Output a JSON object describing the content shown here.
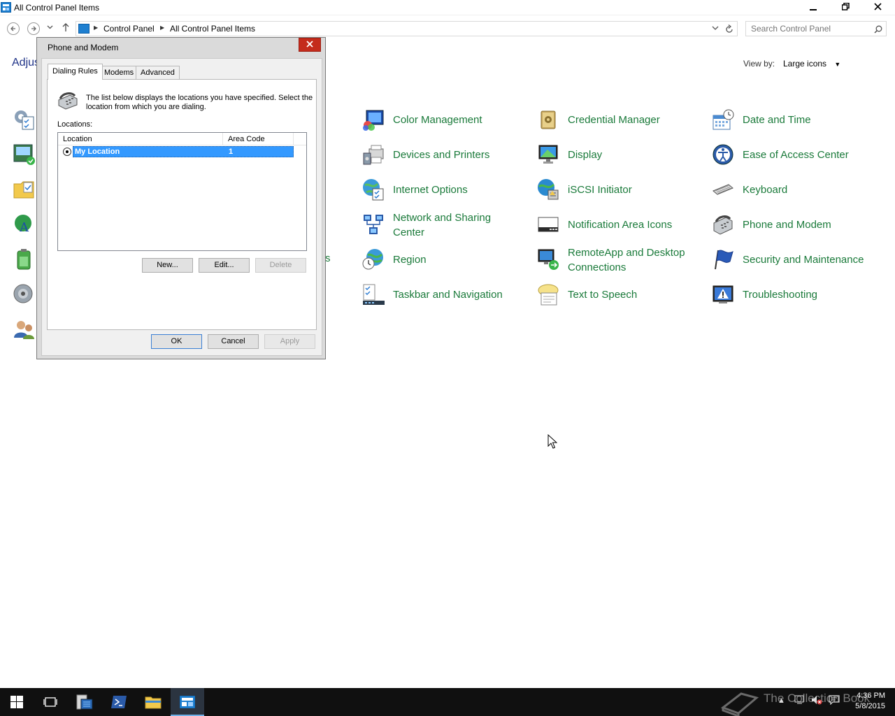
{
  "window": {
    "title": "All Control Panel Items",
    "minimize_glyph": "—",
    "maximize_glyph": "❐",
    "close_glyph": "✕"
  },
  "address": {
    "crumbs": [
      "Control Panel",
      "All Control Panel Items"
    ],
    "search_placeholder": "Search Control Panel"
  },
  "content": {
    "heading_partial": "Adjus",
    "view_by_label": "View by:",
    "view_by_value": "Large icons",
    "partial_item_suffix": "s"
  },
  "items": {
    "color_management": "Color Management",
    "credential_manager": "Credential Manager",
    "date_and_time": "Date and Time",
    "devices_and_printers": "Devices and Printers",
    "display": "Display",
    "ease_of_access": "Ease of Access Center",
    "internet_options": "Internet Options",
    "iscsi_initiator": "iSCSI Initiator",
    "keyboard": "Keyboard",
    "network_sharing_1": "Network and Sharing",
    "network_sharing_2": "Center",
    "notification_area": "Notification Area Icons",
    "phone_and_modem": "Phone and Modem",
    "region": "Region",
    "remoteapp_1": "RemoteApp and Desktop",
    "remoteapp_2": "Connections",
    "security_maintenance": "Security and Maintenance",
    "taskbar_navigation": "Taskbar and Navigation",
    "text_to_speech": "Text to Speech",
    "troubleshooting": "Troubleshooting"
  },
  "dialog": {
    "title": "Phone and Modem",
    "close_glyph": "✕",
    "tabs": [
      "Dialing Rules",
      "Modems",
      "Advanced"
    ],
    "description": "The list below displays the locations you have specified. Select the location from which you are dialing.",
    "locations_label": "Locations:",
    "columns": [
      "Location",
      "Area Code"
    ],
    "rows": [
      {
        "location": "My Location",
        "area_code": "1"
      }
    ],
    "buttons": {
      "new": "New...",
      "edit": "Edit...",
      "delete": "Delete",
      "ok": "OK",
      "cancel": "Cancel",
      "apply": "Apply"
    }
  },
  "taskbar": {
    "watermark": "The Collection Book",
    "time": "4:36 PM",
    "date": "5/8/2015"
  },
  "colors": {
    "link_green": "#1a7a3a",
    "heading_blue": "#1e3287",
    "selection_blue": "#3399ff",
    "close_red": "#c42b1c"
  }
}
